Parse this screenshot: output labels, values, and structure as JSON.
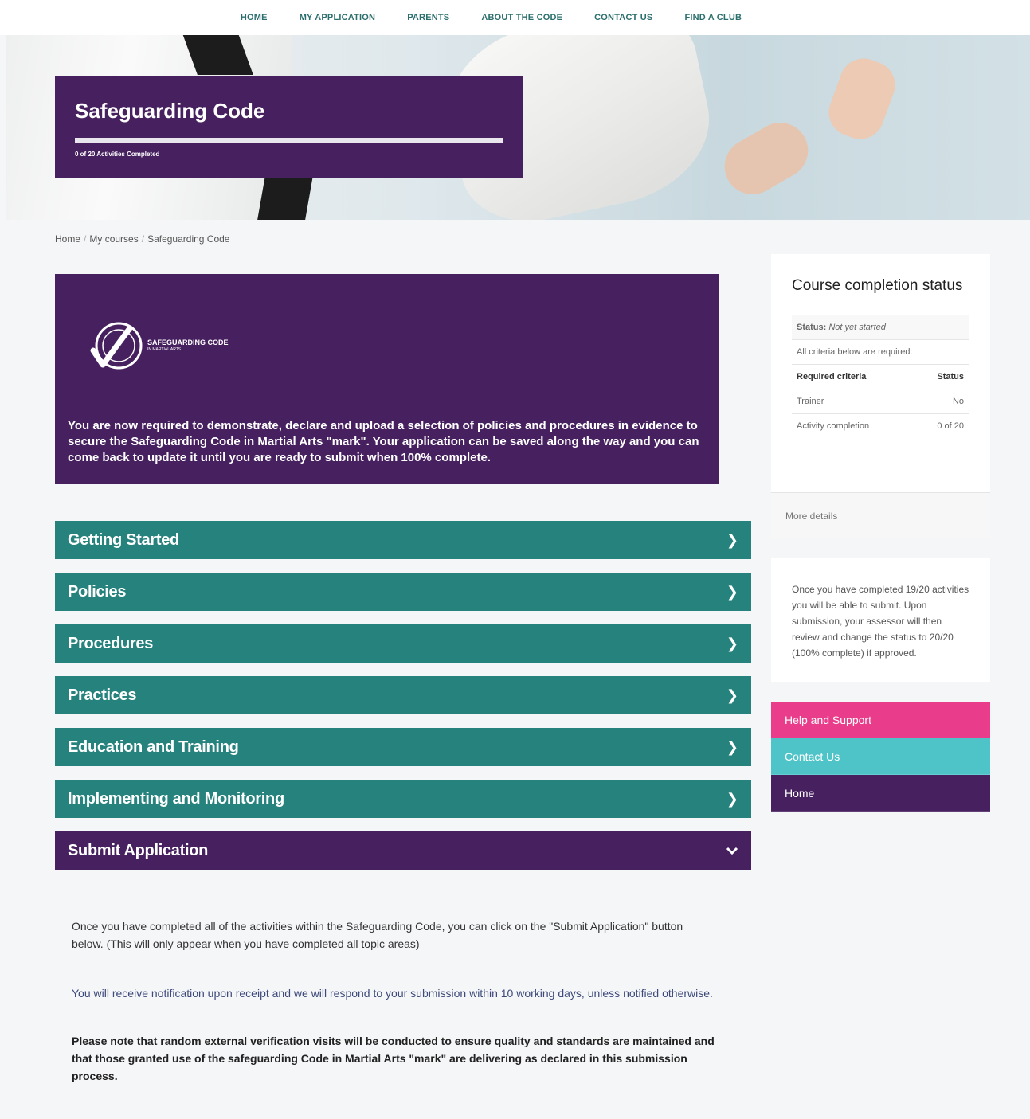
{
  "nav": {
    "items": [
      "HOME",
      "MY APPLICATION",
      "PARENTS",
      "ABOUT THE CODE",
      "CONTACT US",
      "FIND A CLUB"
    ]
  },
  "hero": {
    "title": "Safeguarding Code",
    "progress_label": "0 of 20 Activities Completed",
    "progress_fraction": 0
  },
  "breadcrumb": {
    "items": [
      "Home",
      "My courses",
      "Safeguarding Code"
    ]
  },
  "intro": {
    "logo_title": "SAFEGUARDING CODE",
    "logo_subtitle": "IN MARTIAL ARTS",
    "text": "You are now required to demonstrate, declare and upload a selection of policies and procedures in evidence to secure the Safeguarding Code in Martial Arts \"mark\". Your application can be saved along the way and you can come back to update it until you are ready to submit when 100% complete."
  },
  "sections": [
    {
      "label": "Getting Started",
      "icon": "chevron-right-icon",
      "expanded": false
    },
    {
      "label": "Policies",
      "icon": "chevron-right-icon",
      "expanded": false
    },
    {
      "label": "Procedures",
      "icon": "chevron-right-icon",
      "expanded": false
    },
    {
      "label": "Practices",
      "icon": "chevron-right-icon",
      "expanded": false
    },
    {
      "label": "Education and Training",
      "icon": "chevron-right-icon",
      "expanded": false
    },
    {
      "label": "Implementing and Monitoring",
      "icon": "chevron-right-icon",
      "expanded": false
    },
    {
      "label": "Submit Application",
      "icon": "chevron-down-icon",
      "expanded": true
    }
  ],
  "submit": {
    "p1": "Once you have completed all of the activities within the Safeguarding Code, you can click on the \"Submit Application\" button below. (This will only appear when you have completed all topic areas)",
    "p2": "You will receive notification upon receipt and we will respond to your submission within 10 working days, unless notified otherwise.",
    "p3": "Please note that random external verification visits will be conducted to ensure quality and standards are maintained and that those granted use of the safeguarding Code in Martial Arts \"mark\" are delivering as declared in this submission process."
  },
  "status_card": {
    "title": "Course completion status",
    "status_label": "Status:",
    "status_value": "Not yet started",
    "criteria_note": "All criteria below are required:",
    "col_criteria": "Required criteria",
    "col_status": "Status",
    "rows": [
      {
        "criteria": "Trainer",
        "status": "No"
      },
      {
        "criteria": "Activity completion",
        "status": "0 of 20"
      }
    ],
    "more_details": "More details"
  },
  "note": {
    "text": "Once you have completed 19/20 activities you will be able to submit. Upon submission, your assessor will then review and change the status to 20/20 (100% complete) if approved."
  },
  "side_links": {
    "help": "Help and Support",
    "contact": "Contact Us",
    "home": "Home"
  },
  "colors": {
    "purple": "#47205f",
    "teal": "#26827d",
    "pink": "#e93c8a",
    "light_teal": "#4fc4c8"
  }
}
